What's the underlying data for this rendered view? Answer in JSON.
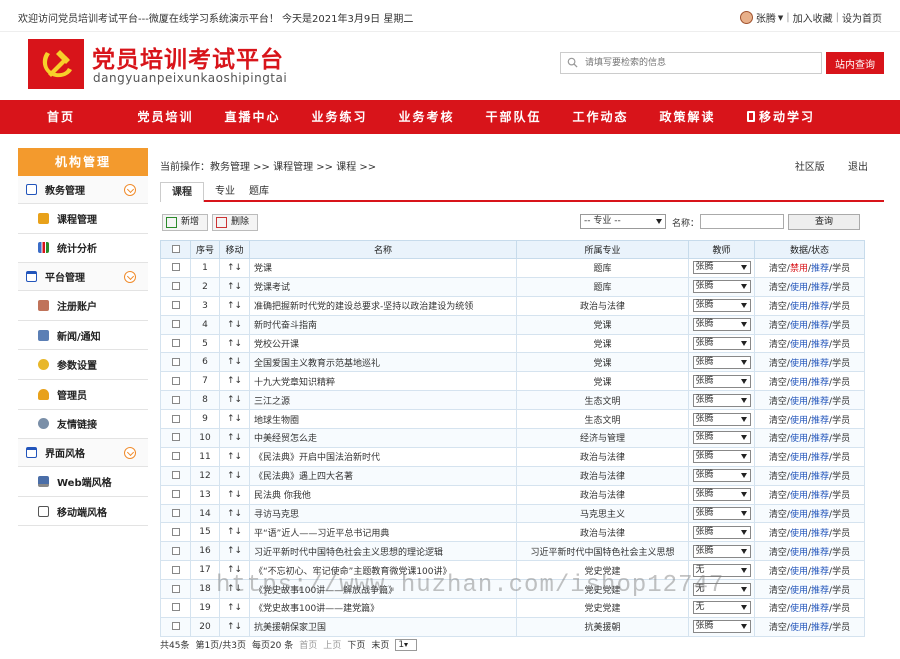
{
  "topbar": {
    "welcome": "欢迎访问党员培训考试平台---微厦在线学习系统演示平台！ 今天是2021年3月9日 星期二",
    "user": "张腾",
    "favorite": "加入收藏",
    "homepage": "设为首页"
  },
  "header": {
    "title": "党员培训考试平台",
    "subtitle": "dangyuanpeixunkaoshipingtai",
    "search_placeholder": "请填写要检索的信息",
    "search_button": "站内查询"
  },
  "nav": [
    "首页",
    "党员培训",
    "直播中心",
    "业务练习",
    "业务考核",
    "干部队伍",
    "工作动态",
    "政策解读",
    "移动学习"
  ],
  "sidebar": {
    "title": "机构管理",
    "groups": [
      {
        "label": "教务管理",
        "items": [
          "课程管理",
          "统计分析"
        ]
      },
      {
        "label": "平台管理",
        "items": [
          "注册账户",
          "新闻/通知",
          "参数设置",
          "管理员",
          "友情链接"
        ]
      },
      {
        "label": "界面风格",
        "items": [
          "Web端风格",
          "移动端风格"
        ]
      }
    ]
  },
  "content": {
    "breadcrumb": "当前操作：教务管理 >> 课程管理 >> 课程 >>",
    "community": "社区版",
    "logout": "退出",
    "tabs": [
      "课程",
      "专业",
      "题库"
    ],
    "toolbar": {
      "add": "新增",
      "delete": "删除",
      "major_select": "-- 专业 --",
      "name_label": "名称：",
      "query": "查询"
    },
    "columns": [
      "序号",
      "移动",
      "名称",
      "所属专业",
      "教师",
      "数据/状态"
    ],
    "move_label": "↑↓",
    "actions": {
      "clear": "清空",
      "enable": "使用",
      "disable": "禁用",
      "recommend": "推荐",
      "students": "学员",
      "sep": "/"
    },
    "rows": [
      {
        "no": "1",
        "name": "党课",
        "major": "题库",
        "teacher": "张腾",
        "status": "禁用"
      },
      {
        "no": "2",
        "name": "党课考试",
        "major": "题库",
        "teacher": "张腾",
        "status": "使用"
      },
      {
        "no": "3",
        "name": "准确把握新时代党的建设总要求-坚持以政治建设为统领",
        "major": "政治与法律",
        "teacher": "张腾",
        "status": "使用"
      },
      {
        "no": "4",
        "name": "新时代奋斗指南",
        "major": "党课",
        "teacher": "张腾",
        "status": "使用"
      },
      {
        "no": "5",
        "name": "党校公开课",
        "major": "党课",
        "teacher": "张腾",
        "status": "使用"
      },
      {
        "no": "6",
        "name": "全国爱国主义教育示范基地巡礼",
        "major": "党课",
        "teacher": "张腾",
        "status": "使用"
      },
      {
        "no": "7",
        "name": "十九大党章知识精粹",
        "major": "党课",
        "teacher": "张腾",
        "status": "使用"
      },
      {
        "no": "8",
        "name": "三江之源",
        "major": "生态文明",
        "teacher": "张腾",
        "status": "使用"
      },
      {
        "no": "9",
        "name": "地球生物圈",
        "major": "生态文明",
        "teacher": "张腾",
        "status": "使用"
      },
      {
        "no": "10",
        "name": "中美经贸怎么走",
        "major": "经济与管理",
        "teacher": "张腾",
        "status": "使用"
      },
      {
        "no": "11",
        "name": "《民法典》开启中国法治新时代",
        "major": "政治与法律",
        "teacher": "张腾",
        "status": "使用"
      },
      {
        "no": "12",
        "name": "《民法典》遇上四大名著",
        "major": "政治与法律",
        "teacher": "张腾",
        "status": "使用"
      },
      {
        "no": "13",
        "name": "民法典 你我他",
        "major": "政治与法律",
        "teacher": "张腾",
        "status": "使用"
      },
      {
        "no": "14",
        "name": "寻访马克思",
        "major": "马克思主义",
        "teacher": "张腾",
        "status": "使用"
      },
      {
        "no": "15",
        "name": "平“语”近人——习近平总书记用典",
        "major": "政治与法律",
        "teacher": "张腾",
        "status": "使用"
      },
      {
        "no": "16",
        "name": "习近平新时代中国特色社会主义思想的理论逻辑",
        "major": "习近平新时代中国特色社会主义思想",
        "teacher": "张腾",
        "status": "使用"
      },
      {
        "no": "17",
        "name": "《“不忘初心、牢记使命”主题教育微党课100讲》",
        "major": "党史党建",
        "teacher": "无",
        "status": "使用"
      },
      {
        "no": "18",
        "name": "《党史故事100讲——解放战争篇》",
        "major": "党史党建",
        "teacher": "无",
        "status": "使用"
      },
      {
        "no": "19",
        "name": "《党史故事100讲——建党篇》",
        "major": "党史党建",
        "teacher": "无",
        "status": "使用"
      },
      {
        "no": "20",
        "name": "抗美援朝保家卫国",
        "major": "抗美援朝",
        "teacher": "张腾",
        "status": "使用"
      }
    ],
    "pager": {
      "total": "共45条",
      "page": "第1页/共3页",
      "per_page": "每页20 条",
      "first": "首页",
      "prev": "上页",
      "next": "下页",
      "last": "末页",
      "current": "1"
    }
  },
  "watermark": "https://www.huzhan.com/ishop12747",
  "colors": {
    "brand": "#d8141a",
    "sidebar_head": "#f39a2d",
    "link": "#2255bb"
  }
}
